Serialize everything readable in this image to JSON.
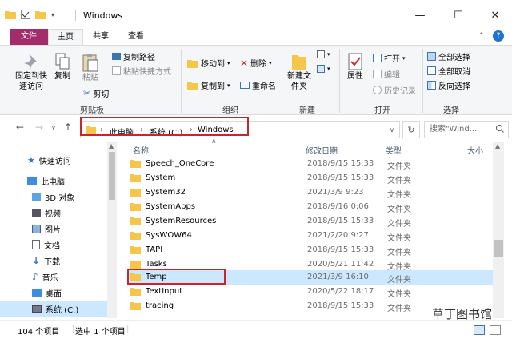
{
  "window": {
    "title": "Windows",
    "controls": {
      "minimize": "—",
      "maximize": "☐",
      "close": "✕"
    }
  },
  "tabs": [
    {
      "label": "文件"
    },
    {
      "label": "主页"
    },
    {
      "label": "共享"
    },
    {
      "label": "查看"
    }
  ],
  "ribbon": {
    "pin_quick_access": "固定到快速访问",
    "copy": "复制",
    "paste": "粘贴",
    "copy_path": "复制路径",
    "paste_shortcut": "粘贴快捷方式",
    "cut": "剪切",
    "clipboard_group": "剪贴板",
    "move_to": "移动到",
    "copy_to": "复制到",
    "delete": "删除",
    "rename": "重命名",
    "organize_group": "组织",
    "new_folder": "新建文件夹",
    "new_group": "新建",
    "properties": "属性",
    "open": "打开",
    "edit": "编辑",
    "history": "历史记录",
    "open_group": "打开",
    "select_all": "全部选择",
    "select_none": "全部取消",
    "invert_selection": "反向选择",
    "select_group": "选择"
  },
  "address": {
    "crumbs": [
      "此电脑",
      "系统 (C:)",
      "Windows"
    ],
    "search_placeholder": "搜索\"Wind..."
  },
  "nav": [
    {
      "label": "快速访问"
    },
    {
      "label": "此电脑"
    },
    {
      "label": "3D 对象"
    },
    {
      "label": "视频"
    },
    {
      "label": "图片"
    },
    {
      "label": "文档"
    },
    {
      "label": "下载"
    },
    {
      "label": "音乐"
    },
    {
      "label": "桌面"
    },
    {
      "label": "系统 (C:)"
    }
  ],
  "columns": {
    "name": "名称",
    "date": "修改日期",
    "type": "类型",
    "size": "大小"
  },
  "files": [
    {
      "name": "Speech_OneCore",
      "date": "2018/9/15 15:33",
      "type": "文件夹"
    },
    {
      "name": "System",
      "date": "2018/9/15 15:33",
      "type": "文件夹"
    },
    {
      "name": "System32",
      "date": "2021/3/9 9:23",
      "type": "文件夹"
    },
    {
      "name": "SystemApps",
      "date": "2018/9/16 0:06",
      "type": "文件夹"
    },
    {
      "name": "SystemResources",
      "date": "2018/9/15 15:33",
      "type": "文件夹"
    },
    {
      "name": "SysWOW64",
      "date": "2021/2/20 9:27",
      "type": "文件夹"
    },
    {
      "name": "TAPI",
      "date": "2018/9/15 15:33",
      "type": "文件夹"
    },
    {
      "name": "Tasks",
      "date": "2020/5/21 11:42",
      "type": "文件夹"
    },
    {
      "name": "Temp",
      "date": "2021/3/9 16:10",
      "type": "文件夹"
    },
    {
      "name": "TextInput",
      "date": "2020/5/22 18:17",
      "type": "文件夹"
    },
    {
      "name": "tracing",
      "date": "2018/9/15 15:33",
      "type": "文件夹"
    }
  ],
  "status": {
    "count": "104 个项目",
    "selected": "选中 1 个项目"
  },
  "watermark": "草丁图书馆"
}
